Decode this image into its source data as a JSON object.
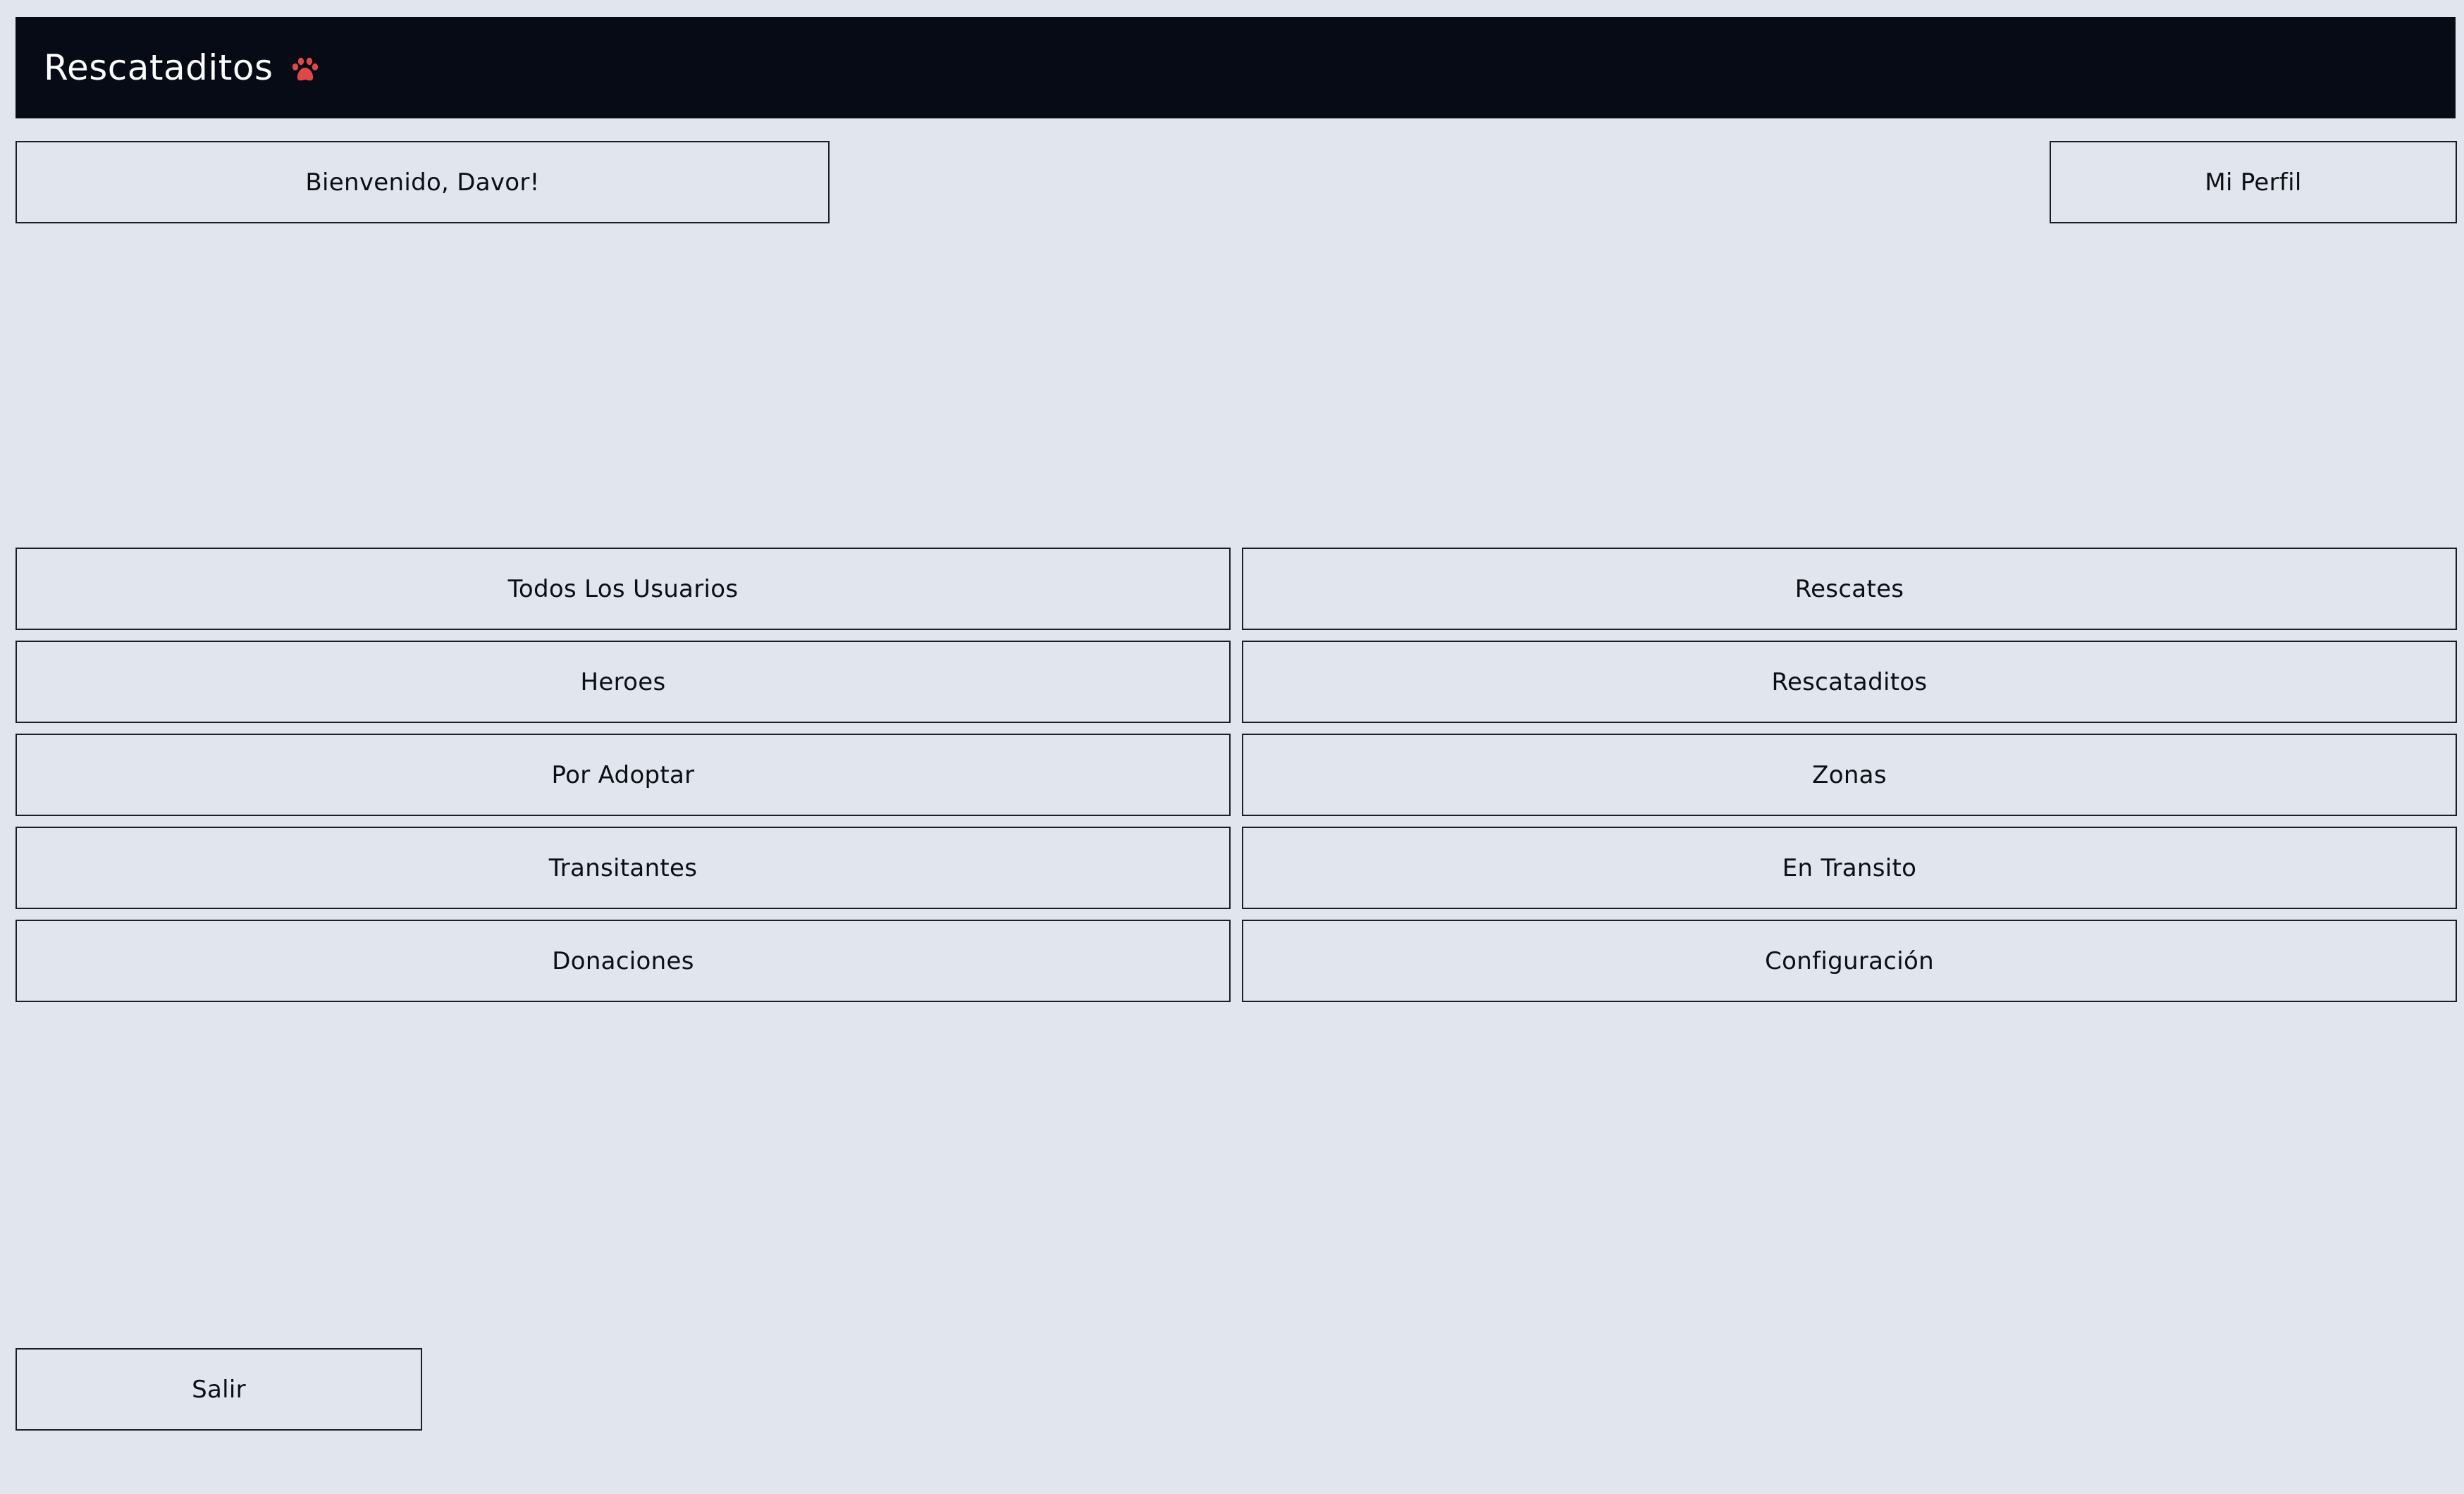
{
  "header": {
    "title": "Rescataditos",
    "icon": "paw-icon",
    "background": "#070b15",
    "icon_color": "#e04848"
  },
  "welcome": {
    "label": "Bienvenido, Davor!"
  },
  "profile": {
    "label": "Mi Perfil"
  },
  "menu": {
    "items": [
      {
        "label": "Todos Los Usuarios"
      },
      {
        "label": "Rescates"
      },
      {
        "label": "Heroes"
      },
      {
        "label": "Rescataditos"
      },
      {
        "label": "Por Adoptar"
      },
      {
        "label": "Zonas"
      },
      {
        "label": "Transitantes"
      },
      {
        "label": "En Transito"
      },
      {
        "label": "Donaciones"
      },
      {
        "label": "Configuración"
      }
    ]
  },
  "logout": {
    "label": "Salir"
  },
  "colors": {
    "page_background": "#e0e5ee",
    "border": "#1a1e2a",
    "text": "#0c0e14"
  }
}
